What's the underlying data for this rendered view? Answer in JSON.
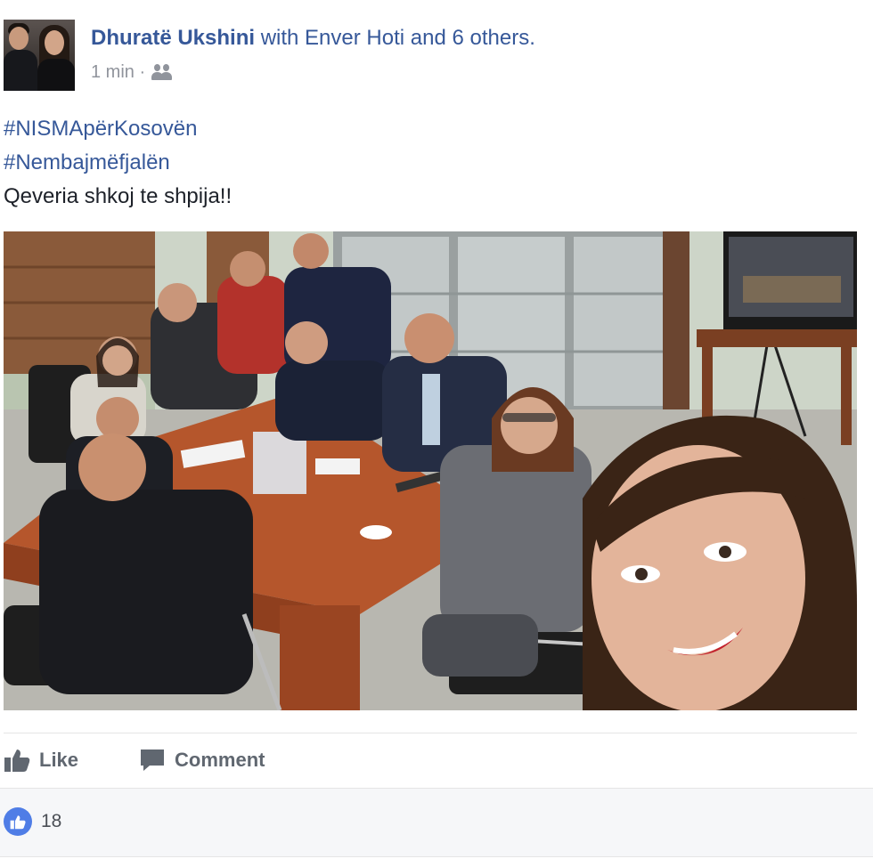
{
  "post": {
    "author": "Dhuratë Ukshini",
    "with_text": "with Enver Hoti and 6 others.",
    "timestamp": "1 min ·",
    "audience_icon": "friends-icon",
    "text": {
      "hashtag_1": "#NISMApërKosovën",
      "hashtag_2": "#Nembajmëfjalën",
      "body": "Qeveria shkoj te shpija!!"
    }
  },
  "actions": {
    "like_label": "Like",
    "comment_label": "Comment"
  },
  "reactions": {
    "count": "18"
  },
  "colors": {
    "link": "#365899",
    "meta": "#90949c",
    "action": "#606770",
    "like_badge": "#4f7de6",
    "summary_bg": "#f6f7f9"
  }
}
